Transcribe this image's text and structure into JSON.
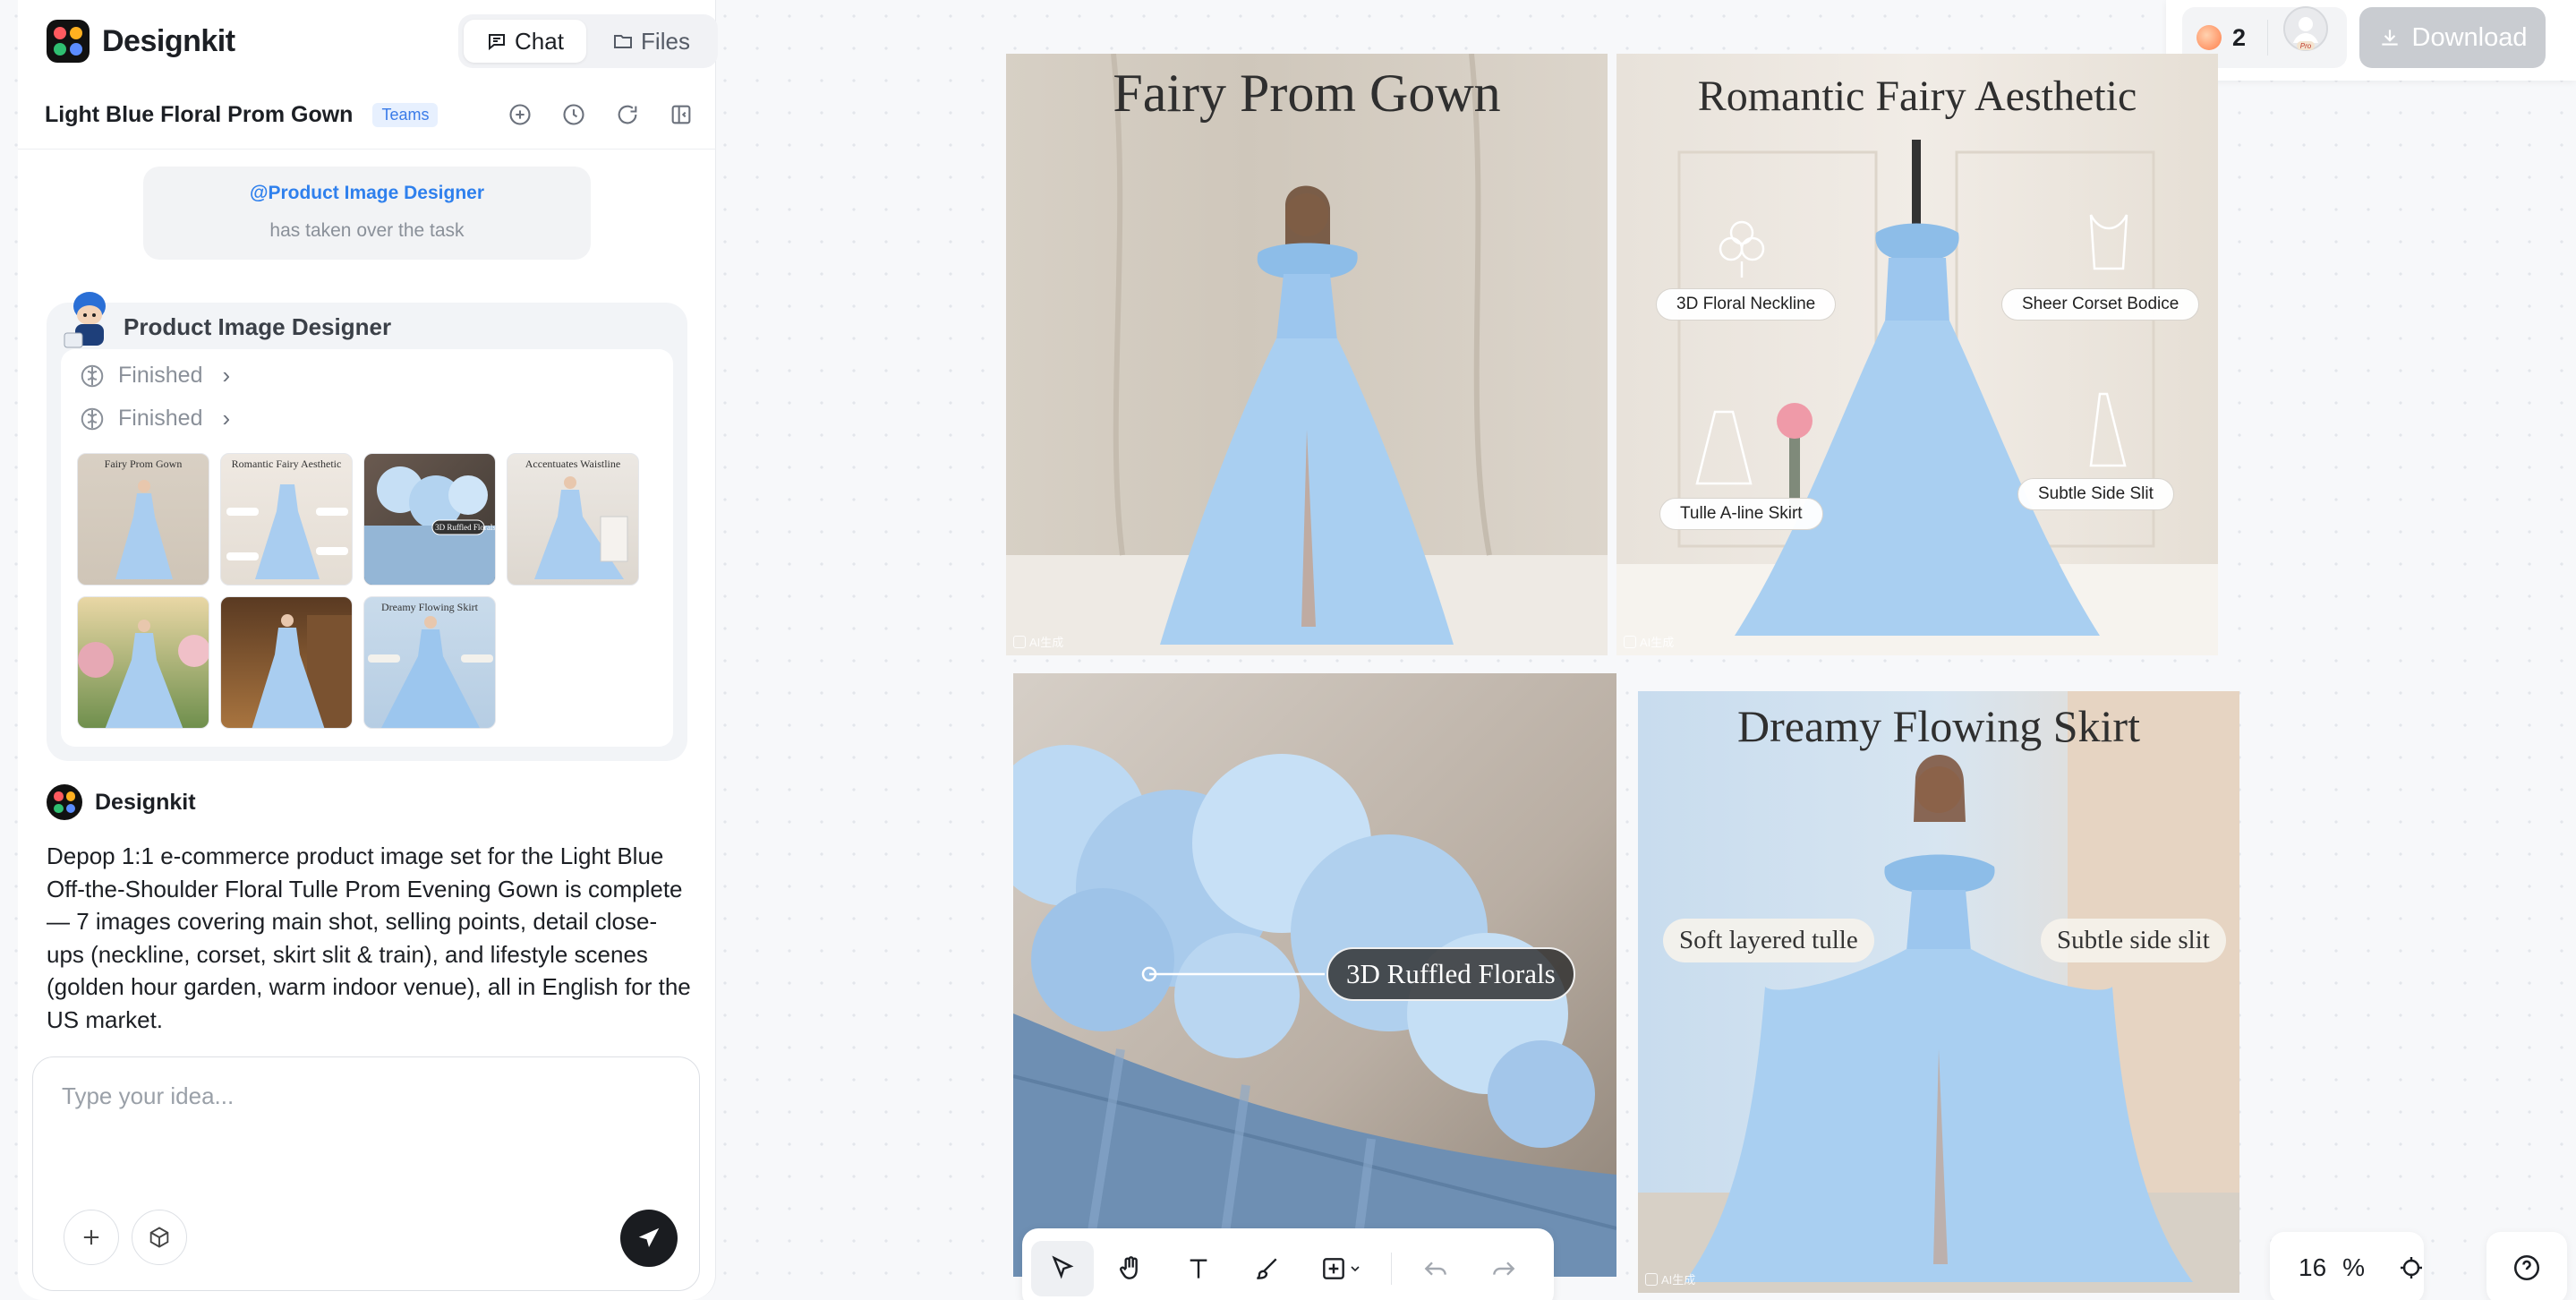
{
  "app": {
    "name": "Designkit",
    "logo_colors": [
      "#ff5a5f",
      "#ffb020",
      "#2fbf71",
      "#5b8cff"
    ]
  },
  "header": {
    "tabs": [
      {
        "label": "Chat",
        "icon": "chat-icon",
        "active": true
      },
      {
        "label": "Files",
        "icon": "folder-icon",
        "active": false
      }
    ],
    "project_title": "Light Blue Floral Prom Gown",
    "project_badge": "Teams",
    "actions": [
      "new-chat-icon",
      "history-icon",
      "refresh-icon",
      "collapse-panel-icon"
    ]
  },
  "takeover": {
    "agent": "@Product Image Designer",
    "text": "has taken over the task"
  },
  "agent_card": {
    "name": "Product Image Designer",
    "steps": [
      {
        "label": "Finished",
        "icon": "brain-icon"
      },
      {
        "label": "Finished",
        "icon": "brain-icon"
      }
    ],
    "thumbnails": [
      {
        "label": "Fairy Prom Gown"
      },
      {
        "label": "Romantic Fairy Aesthetic"
      },
      {
        "label": "3D Ruffled Florals"
      },
      {
        "label": "Accentuates Waistline"
      },
      {
        "label": ""
      },
      {
        "label": ""
      },
      {
        "label": "Dreamy Flowing Skirt"
      }
    ]
  },
  "bot": {
    "name": "Designkit",
    "message": "Depop 1:1 e-commerce product image set for the Light Blue Off-the-Shoulder Floral Tulle Prom Evening Gown is complete — 7 images covering main shot, selling points, detail close-ups (neckline, corset, skirt slit & train), and lifestyle scenes (golden hour garden, warm indoor venue), all in English for the US market."
  },
  "composer": {
    "placeholder": "Type your idea...",
    "value": ""
  },
  "topbar": {
    "credits": "2",
    "avatar_badge": "Pro",
    "download_label": "Download"
  },
  "canvas": {
    "images": [
      {
        "title": "Fairy Prom Gown",
        "watermark": "AI生成"
      },
      {
        "title": "Romantic Fairy Aesthetic",
        "watermark": "AI生成",
        "labels": [
          "3D Floral Neckline",
          "Sheer Corset Bodice",
          "Tulle A-line Skirt",
          "Subtle Side Slit"
        ]
      },
      {
        "title": "",
        "watermark": "",
        "callout": "3D Ruffled Florals"
      },
      {
        "title": "Dreamy Flowing Skirt",
        "watermark": "AI生成",
        "labels": [
          "Soft layered tulle",
          "Subtle side slit"
        ]
      }
    ]
  },
  "toolbar": {
    "tools": [
      "select-icon",
      "hand-icon",
      "text-icon",
      "brush-icon",
      "add-frame-icon",
      "undo-icon",
      "redo-icon"
    ],
    "active_tool": "select-icon"
  },
  "zoom": {
    "value": "16",
    "unit": "%"
  },
  "colors": {
    "accent_blue": "#2f80ed",
    "gown_blue": "#9cc6ee",
    "send_button": "#1a1c20",
    "download_disabled": "#c9ccd1"
  }
}
